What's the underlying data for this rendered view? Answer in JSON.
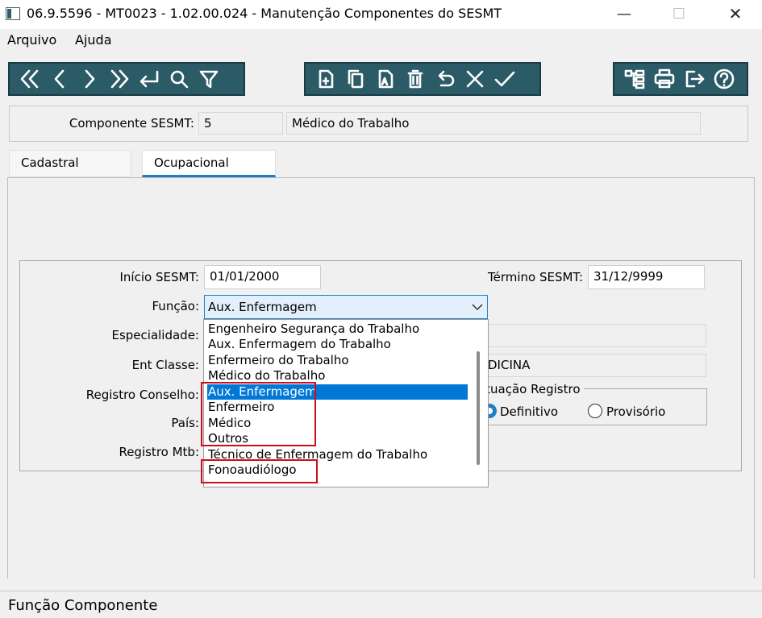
{
  "window": {
    "title": "06.9.5596 - MT0023 - 1.02.00.024 - Manutenção Componentes do SESMT",
    "minimize": "—",
    "maximize": "☐",
    "close": "✕"
  },
  "menu": {
    "arquivo": "Arquivo",
    "ajuda": "Ajuda"
  },
  "header": {
    "label": "Componente SESMT:",
    "code": "5",
    "name": "Médico do Trabalho"
  },
  "tabs": {
    "cadastral": "Cadastral",
    "ocupacional": "Ocupacional"
  },
  "form": {
    "inicio_label": "Início SESMT:",
    "inicio_value": "01/01/2000",
    "termino_label": "Término SESMT:",
    "termino_value": "31/12/9999",
    "funcao_label": "Função:",
    "funcao_value": "Aux. Enfermagem",
    "especialidade_label": "Especialidade:",
    "ent_classe_label": "Ent Classe:",
    "ent_classe_value": "DICINA",
    "registro_conselho_label": "Registro Conselho:",
    "pais_label": "País:",
    "registro_mtb_label": "Registro Mtb:"
  },
  "dropdown": {
    "options": [
      "Engenheiro Segurança do Trabalho",
      "Aux. Enfermagem do Trabalho",
      "Enfermeiro do Trabalho",
      "Médico do Trabalho",
      "Aux. Enfermagem",
      "Enfermeiro",
      "Médico",
      "Outros",
      "Técnico de Enfermagem do Trabalho",
      "Fonoaudiólogo"
    ],
    "selected": "Aux. Enfermagem"
  },
  "situacao": {
    "label": "ituação Registro",
    "definitivo": "Definitivo",
    "provisorio": "Provisório",
    "checked": "Definitivo"
  },
  "status": {
    "text": "Função Componente"
  },
  "colors": {
    "toolbar": "#2b5b67",
    "accent": "#1e7ec8",
    "highlight": "#d10b1e"
  }
}
